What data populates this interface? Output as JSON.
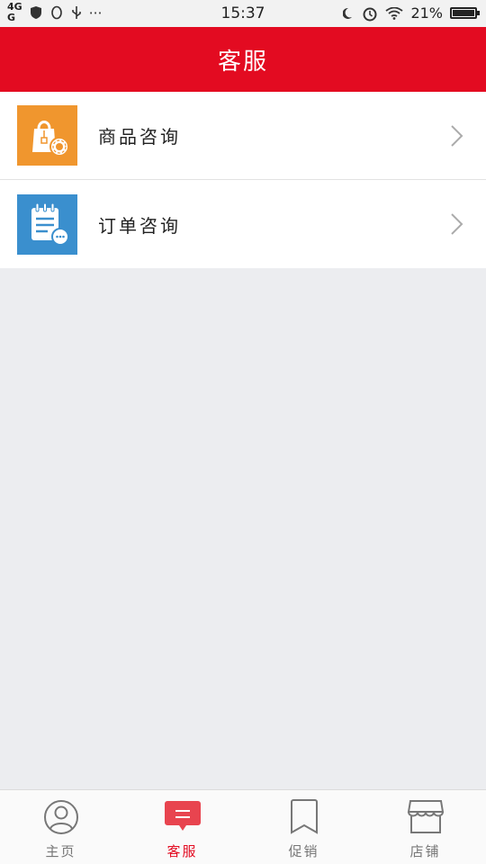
{
  "status_bar": {
    "network_top": "4G",
    "network_bottom": "G",
    "time": "15:37",
    "battery": "21%"
  },
  "header": {
    "title": "客服"
  },
  "menu": [
    {
      "label": "商品咨询",
      "icon": "shopping-bag-icon",
      "icon_color": "#f0962e"
    },
    {
      "label": "订单咨询",
      "icon": "order-notepad-icon",
      "icon_color": "#3a8fce"
    }
  ],
  "tabbar": {
    "items": [
      {
        "label": "主页",
        "icon": "user-circle-icon",
        "active": false
      },
      {
        "label": "客服",
        "icon": "chat-bubble-icon",
        "active": true
      },
      {
        "label": "促销",
        "icon": "bookmark-icon",
        "active": false
      },
      {
        "label": "店铺",
        "icon": "store-icon",
        "active": false
      }
    ],
    "active_color": "#e30b21"
  },
  "colors": {
    "brand": "#e30b21",
    "background": "#ecedf0"
  }
}
